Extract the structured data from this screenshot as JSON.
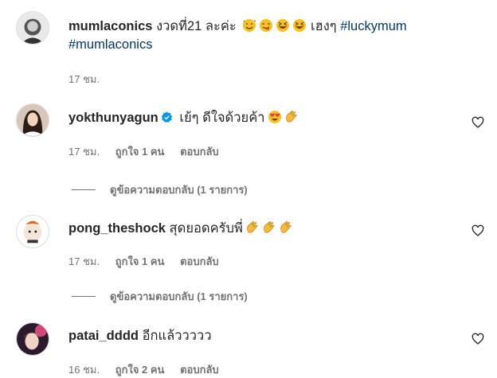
{
  "caption": {
    "username": "mumlaconics",
    "text": "งวดที่21 ละค่ะ",
    "text_after": "เฮงๆ",
    "hashtag1": "#luckymum",
    "hashtag2": "#mumlaconics",
    "emojis": [
      "smiling-face-with-hearts",
      "face-savoring-food",
      "grinning-squinting-face",
      "grinning-squinting-face"
    ],
    "time": "17 ชม."
  },
  "comments": [
    {
      "username": "yokthunyagun",
      "verified": true,
      "text": "เย้ๆ ดีใจด้วยค้า",
      "emojis": [
        "heart-eyes",
        "clapping-hands"
      ],
      "time": "17 ชม.",
      "likes": "ถูกใจ 1 คน",
      "reply": "ตอบกลับ",
      "view_replies": "ดูข้อความตอบกลับ (1 รายการ)"
    },
    {
      "username": "pong_theshock",
      "verified": false,
      "text": "สุดยอดครับพี่",
      "emojis": [
        "clapping-hands",
        "clapping-hands",
        "clapping-hands"
      ],
      "time": "17 ชม.",
      "likes": "ถูกใจ 1 คน",
      "reply": "ตอบกลับ",
      "view_replies": "ดูข้อความตอบกลับ (1 รายการ)"
    },
    {
      "username": "patai_dddd",
      "verified": false,
      "text": "อีกแล้ววววว",
      "emojis": [],
      "time": "16 ชม.",
      "likes": "ถูกใจ 2 คน",
      "reply": "ตอบกลับ"
    }
  ]
}
